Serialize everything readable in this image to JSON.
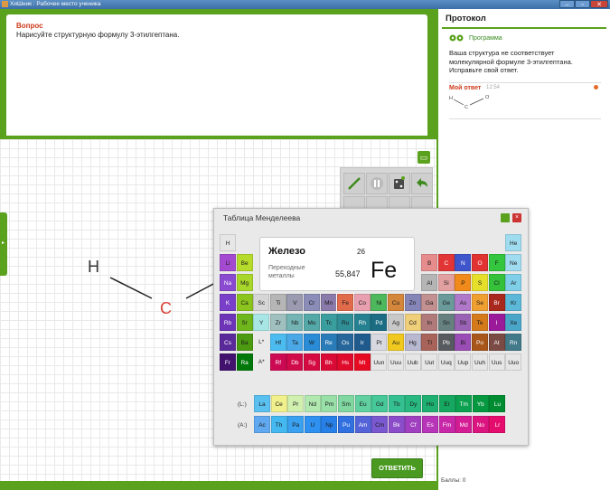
{
  "window": {
    "title": "ХиШник : Рабочее место ученика",
    "controls": [
      "–",
      "▫",
      "✕"
    ]
  },
  "question": {
    "title": "Вопрос",
    "text": "Нарисуйте структурную формулу 3-этилгептана."
  },
  "canvas": {
    "side_tab_glyph": "▸",
    "minimize_glyph": "▭",
    "atoms": {
      "h": "H",
      "c": "C"
    },
    "answer_button": "ОТВЕТИТЬ",
    "toolbar_icons": [
      "pencil-icon",
      "stop-icon",
      "dice-icon",
      "undo-icon",
      "bond-icon",
      "ring-icon",
      "eraser-icon",
      "redo-icon"
    ]
  },
  "protocol": {
    "title": "Протокол",
    "program_label": "Программа",
    "program_message": "Ваша структура не соответствует молекулярной формуле 3-этилгептана. Исправьте свой ответ.",
    "my_answer_label": "Мой ответ",
    "my_answer_time": "12:54",
    "mini_atoms": {
      "h": "H",
      "c": "C",
      "o": "O"
    },
    "score_label": "Баллы: 0"
  },
  "periodic_table": {
    "title": "Таблица Менделеева",
    "selected": {
      "name": "Железо",
      "group": "Переходные металлы",
      "atomic_number": "26",
      "atomic_mass": "55,847",
      "symbol": "Fe"
    },
    "lanthanide_label": "(L:)",
    "actinide_label": "(A:)",
    "rows": [
      [
        {
          "s": "H",
          "c": "#e6e6e6"
        },
        null,
        null,
        null,
        null,
        null,
        null,
        null,
        null,
        null,
        null,
        null,
        null,
        null,
        null,
        null,
        null,
        {
          "s": "He",
          "c": "#9fdcf0"
        }
      ],
      [
        {
          "s": "Li",
          "c": "#a44ad0"
        },
        {
          "s": "Be",
          "c": "#b6db2a"
        },
        null,
        null,
        null,
        null,
        null,
        null,
        null,
        null,
        null,
        null,
        {
          "s": "B",
          "c": "#e68c8c"
        },
        {
          "s": "C",
          "c": "#e23636"
        },
        {
          "s": "N",
          "c": "#3e55cc"
        },
        {
          "s": "O",
          "c": "#e23333"
        },
        {
          "s": "F",
          "c": "#33c63e"
        },
        {
          "s": "Ne",
          "c": "#9fdcf0"
        }
      ],
      [
        {
          "s": "Na",
          "c": "#8b4bd0"
        },
        {
          "s": "Mg",
          "c": "#a8d62a"
        },
        null,
        null,
        null,
        null,
        null,
        null,
        null,
        null,
        null,
        null,
        {
          "s": "Al",
          "c": "#b5b5b5"
        },
        {
          "s": "Si",
          "c": "#e3a0a0"
        },
        {
          "s": "P",
          "c": "#f08a1a"
        },
        {
          "s": "S",
          "c": "#e6df2a"
        },
        {
          "s": "Cl",
          "c": "#35c13a"
        },
        {
          "s": "Ar",
          "c": "#7fcfe8"
        }
      ],
      [
        {
          "s": "K",
          "c": "#7a3fc8"
        },
        {
          "s": "Ca",
          "c": "#8cc41e"
        },
        {
          "s": "Sc",
          "c": "#d6d6d6"
        },
        {
          "s": "Ti",
          "c": "#b6b6b6"
        },
        {
          "s": "V",
          "c": "#9a9ab0"
        },
        {
          "s": "Cr",
          "c": "#8a8db8"
        },
        {
          "s": "Mn",
          "c": "#8a7aaa"
        },
        {
          "s": "Fe",
          "c": "#e06a4a"
        },
        {
          "s": "Co",
          "c": "#e8a0b0"
        },
        {
          "s": "Ni",
          "c": "#4db85c"
        },
        {
          "s": "Cu",
          "c": "#d4863a"
        },
        {
          "s": "Zn",
          "c": "#8585b8"
        },
        {
          "s": "Ga",
          "c": "#c29090"
        },
        {
          "s": "Ge",
          "c": "#6a9a9a"
        },
        {
          "s": "As",
          "c": "#b078c8"
        },
        {
          "s": "Se",
          "c": "#f0a030"
        },
        {
          "s": "Br",
          "c": "#a8281e"
        },
        {
          "s": "Kr",
          "c": "#5cb8d8"
        }
      ],
      [
        {
          "s": "Rb",
          "c": "#6d34b8"
        },
        {
          "s": "Sr",
          "c": "#6fb51c"
        },
        {
          "s": "Y",
          "c": "#a8e6e6"
        },
        {
          "s": "Zr",
          "c": "#a0c0c0"
        },
        {
          "s": "Nb",
          "c": "#74b4b4"
        },
        {
          "s": "Mo",
          "c": "#54a8a8"
        },
        {
          "s": "Tc",
          "c": "#3b9e9e"
        },
        {
          "s": "Ru",
          "c": "#2f8e96"
        },
        {
          "s": "Rh",
          "c": "#258090"
        },
        {
          "s": "Pd",
          "c": "#1c6d84"
        },
        {
          "s": "Ag",
          "c": "#c8c8c8"
        },
        {
          "s": "Cd",
          "c": "#f0cf7a"
        },
        {
          "s": "In",
          "c": "#b07a7a"
        },
        {
          "s": "Sn",
          "c": "#668080"
        },
        {
          "s": "Sb",
          "c": "#9a62b4"
        },
        {
          "s": "Te",
          "c": "#d47a1a"
        },
        {
          "s": "I",
          "c": "#9a1a9a"
        },
        {
          "s": "Xe",
          "c": "#4aa6c8"
        }
      ],
      [
        {
          "s": "Cs",
          "c": "#5a2a9a"
        },
        {
          "s": "Ba",
          "c": "#4c9a12"
        },
        {
          "s": "L*",
          "c": "#e9e9e9"
        },
        {
          "s": "Hf",
          "c": "#4cbcf0"
        },
        {
          "s": "Ta",
          "c": "#4aa8e6"
        },
        {
          "s": "W",
          "c": "#2a8cd6"
        },
        {
          "s": "Re",
          "c": "#2a7cb8"
        },
        {
          "s": "Os",
          "c": "#26669a"
        },
        {
          "s": "Ir",
          "c": "#1f5a8c"
        },
        {
          "s": "Pt",
          "c": "#d8d8e0"
        },
        {
          "s": "Au",
          "c": "#f0c81e"
        },
        {
          "s": "Hg",
          "c": "#b8b8d0"
        },
        {
          "s": "Tl",
          "c": "#a8645a"
        },
        {
          "s": "Pb",
          "c": "#575a5e"
        },
        {
          "s": "Bi",
          "c": "#9a4eb5"
        },
        {
          "s": "Po",
          "c": "#a8561a"
        },
        {
          "s": "At",
          "c": "#7a4a44"
        },
        {
          "s": "Rn",
          "c": "#427a8a"
        }
      ],
      [
        {
          "s": "Fr",
          "c": "#42126e"
        },
        {
          "s": "Ra",
          "c": "#00780a"
        },
        {
          "s": "A*",
          "c": "#e9e9e9"
        },
        {
          "s": "Rf",
          "c": "#cc0a54"
        },
        {
          "s": "Db",
          "c": "#d10a4a"
        },
        {
          "s": "Sg",
          "c": "#d40a40"
        },
        {
          "s": "Bh",
          "c": "#da0a36"
        },
        {
          "s": "Hs",
          "c": "#e00a2c"
        },
        {
          "s": "Mt",
          "c": "#e60a22"
        },
        {
          "s": "Uun",
          "c": "#e6e6e6"
        },
        {
          "s": "Uuu",
          "c": "#e6e6e6"
        },
        {
          "s": "Uub",
          "c": "#e6e6e6"
        },
        {
          "s": "Uut",
          "c": "#e6e6e6"
        },
        {
          "s": "Uuq",
          "c": "#e6e6e6"
        },
        {
          "s": "Uup",
          "c": "#e6e6e6"
        },
        {
          "s": "Uuh",
          "c": "#e6e6e6"
        },
        {
          "s": "Uus",
          "c": "#e6e6e6"
        },
        {
          "s": "Uuo",
          "c": "#e6e6e6"
        }
      ]
    ],
    "lanthanides": [
      {
        "s": "La",
        "c": "#5ac0f0"
      },
      {
        "s": "Ce",
        "c": "#f0f08c"
      },
      {
        "s": "Pr",
        "c": "#d0f0b0"
      },
      {
        "s": "Nd",
        "c": "#b0e8b0"
      },
      {
        "s": "Pm",
        "c": "#98e0a8"
      },
      {
        "s": "Sm",
        "c": "#80d8a0"
      },
      {
        "s": "Eu",
        "c": "#60d0a0"
      },
      {
        "s": "Gd",
        "c": "#46c898"
      },
      {
        "s": "Tb",
        "c": "#34c090"
      },
      {
        "s": "Dy",
        "c": "#28b880"
      },
      {
        "s": "Ho",
        "c": "#1eb070"
      },
      {
        "s": "Er",
        "c": "#16a860"
      },
      {
        "s": "Tm",
        "c": "#0ca050"
      },
      {
        "s": "Yb",
        "c": "#069840"
      },
      {
        "s": "Lu",
        "c": "#008c30"
      }
    ],
    "actinides": [
      {
        "s": "Ac",
        "c": "#60a8f0"
      },
      {
        "s": "Th",
        "c": "#44b8f0"
      },
      {
        "s": "Pa",
        "c": "#3aa0f0"
      },
      {
        "s": "U",
        "c": "#2e90f0"
      },
      {
        "s": "Np",
        "c": "#2680e8"
      },
      {
        "s": "Pu",
        "c": "#3070e0"
      },
      {
        "s": "Am",
        "c": "#5464d8"
      },
      {
        "s": "Cm",
        "c": "#7a58d0"
      },
      {
        "s": "Bk",
        "c": "#8a4cc8"
      },
      {
        "s": "Cf",
        "c": "#a040c0"
      },
      {
        "s": "Es",
        "c": "#b834b8"
      },
      {
        "s": "Fm",
        "c": "#c828a8"
      },
      {
        "s": "Md",
        "c": "#d41c94"
      },
      {
        "s": "No",
        "c": "#dc1480"
      },
      {
        "s": "Lr",
        "c": "#e40c6c"
      }
    ]
  }
}
